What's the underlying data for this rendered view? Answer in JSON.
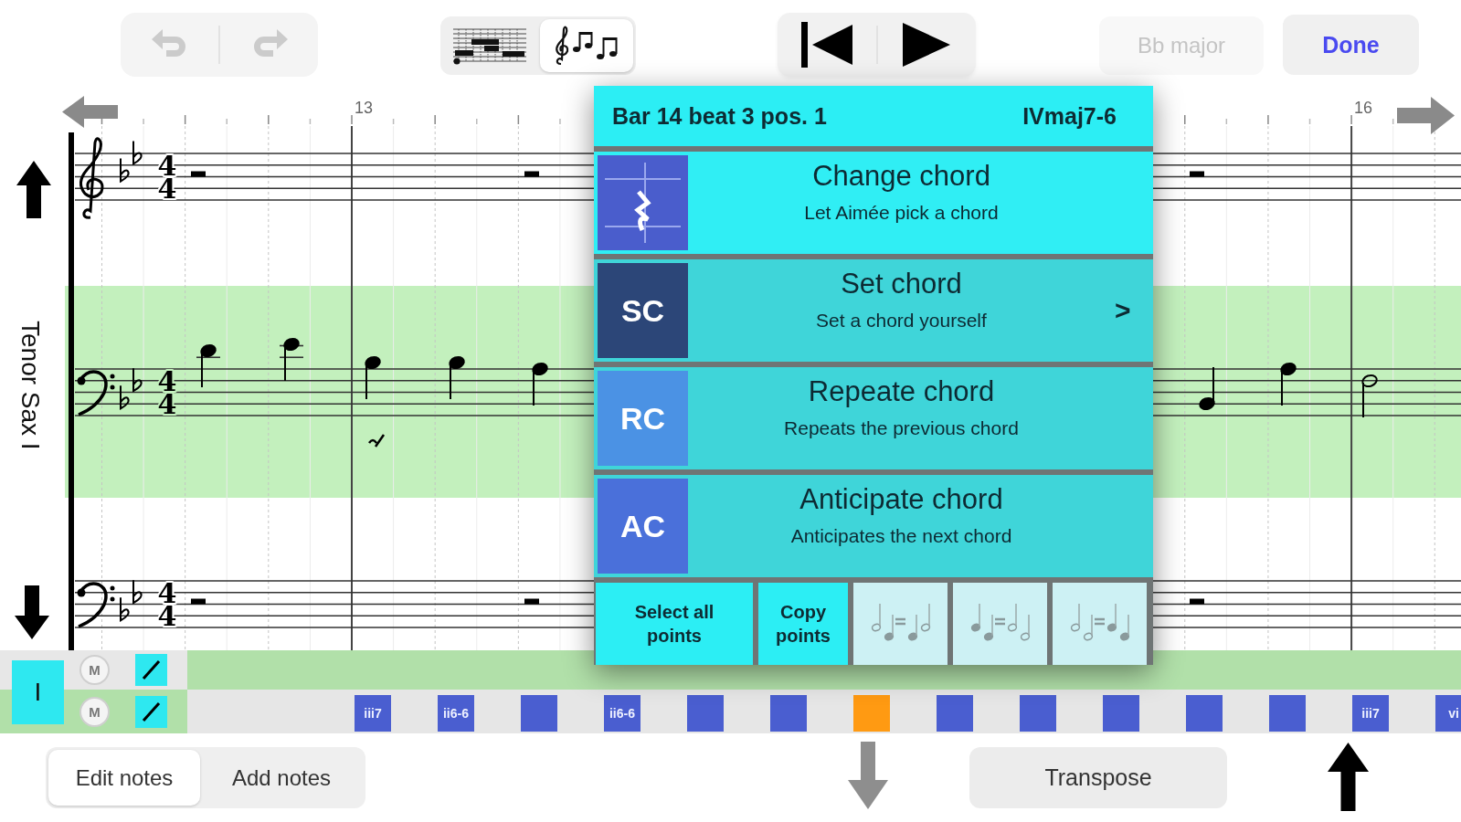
{
  "toolbar": {
    "undo": {
      "disabled": true
    },
    "redo": {
      "disabled": true
    },
    "view_modes": [
      {
        "kind": "grid",
        "selected": false
      },
      {
        "kind": "notation",
        "selected": true
      }
    ],
    "key_button": {
      "label": "Bb major",
      "disabled": true
    },
    "done_button": {
      "label": "Done"
    }
  },
  "ruler": {
    "bar_numbers": [
      "13",
      "16"
    ]
  },
  "instrument": {
    "name": "Tenor Sax I"
  },
  "staves": [
    {
      "kind": "treble",
      "selected": false,
      "time": [
        "4",
        "4"
      ]
    },
    {
      "kind": "bass",
      "selected": true,
      "time": [
        "4",
        "4"
      ]
    },
    {
      "kind": "bass",
      "selected": false,
      "time": [
        "4",
        "4"
      ]
    }
  ],
  "chord_popup": {
    "position": "Bar 14 beat 3 pos. 1",
    "chord": "IVmaj7-6",
    "options": [
      {
        "kind": "icon",
        "title": "Change chord",
        "subtitle": "Let Aimée pick a chord",
        "color": "#4a5dcc",
        "selected": true
      },
      {
        "kind": "abbr",
        "abbr": "SC",
        "title": "Set chord",
        "subtitle": "Set a chord yourself",
        "color": "#2c4678",
        "selected": false,
        "arrow": ">"
      },
      {
        "kind": "abbr",
        "abbr": "RC",
        "title": "Repeate chord",
        "subtitle": "Repeats the previous chord",
        "color": "#4b92e4",
        "selected": false
      },
      {
        "kind": "abbr",
        "abbr": "AC",
        "title": "Anticipate chord",
        "subtitle": "Anticipates the next chord",
        "color": "#4a70da",
        "selected": false
      }
    ],
    "actions": [
      {
        "kind": "text",
        "label": "Select all points",
        "disabled": false
      },
      {
        "kind": "text",
        "label": "Copy points",
        "disabled": false
      },
      {
        "kind": "pattern",
        "disabled": true
      },
      {
        "kind": "pattern",
        "disabled": true
      },
      {
        "kind": "pattern",
        "disabled": true
      }
    ]
  },
  "tracks": {
    "tile": "I",
    "rows": [
      {
        "mute": "M"
      },
      {
        "mute": "M"
      }
    ]
  },
  "chords": [
    {
      "label": "iii7",
      "selected": false
    },
    {
      "label": "ii6-6",
      "selected": false
    },
    {
      "selected": false
    },
    {
      "label": "ii6-6",
      "selected": false
    },
    {
      "selected": false
    },
    {
      "selected": false
    },
    {
      "selected": true
    },
    {
      "selected": false
    },
    {
      "selected": false
    },
    {
      "selected": false
    },
    {
      "selected": false
    },
    {
      "selected": false
    },
    {
      "label": "iii7",
      "selected": false
    },
    {
      "label": "vi",
      "selected": false
    }
  ],
  "edit_modes": [
    {
      "label": "Edit notes",
      "selected": true
    },
    {
      "label": "Add notes",
      "selected": false
    }
  ],
  "move_down": {
    "disabled": true
  },
  "transpose_button": {
    "label": "Transpose"
  },
  "move_up": {
    "disabled": false
  }
}
